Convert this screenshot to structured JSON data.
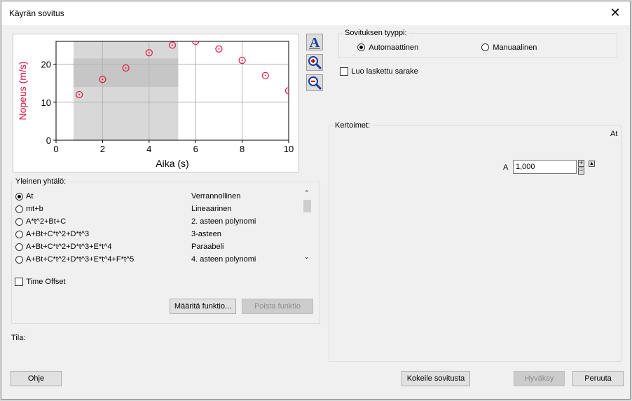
{
  "window": {
    "title": "Käyrän sovitus",
    "close_label": "✕"
  },
  "fit_type": {
    "label": "Sovituksen tyyppi:",
    "options": [
      {
        "label": "Automaattinen",
        "selected": true
      },
      {
        "label": "Manuaalinen",
        "selected": false
      }
    ]
  },
  "calc_column": {
    "label": "Luo laskettu sarake",
    "checked": false
  },
  "coefficients": {
    "label": "Kertoimet:",
    "equation": "At",
    "param_name": "A",
    "param_value": "1,000"
  },
  "general_equation": {
    "label": "Yleinen yhtälö:",
    "items": [
      {
        "eq": "At",
        "desc": "Verrannollinen",
        "selected": true
      },
      {
        "eq": "mt+b",
        "desc": "Lineaarinen",
        "selected": false
      },
      {
        "eq": "A*t^2+Bt+C",
        "desc": "2. asteen polynomi",
        "selected": false
      },
      {
        "eq": "A+Bt+C*t^2+D*t^3",
        "desc": "3-asteen",
        "selected": false
      },
      {
        "eq": "A+Bt+C*t^2+D*t^3+E*t^4",
        "desc": "Paraabeli",
        "selected": false
      },
      {
        "eq": "A+Bt+C*t^2+D*t^3+E*t^4+F*t^5",
        "desc": "4. asteen polynomi",
        "selected": false
      }
    ]
  },
  "time_offset": {
    "label": "Time Offset",
    "checked": false
  },
  "buttons": {
    "define_function": "Määritä funktio...",
    "remove_function": "Poista funktio",
    "help": "Ohje",
    "try_fit": "Kokeile sovitusta",
    "accept": "Hyväksy",
    "cancel": "Peruuta"
  },
  "status_label": "Tila:",
  "colors": {
    "data_point": "#e0143c",
    "ylabel": "#e0143c",
    "selection": "#d8d8d8"
  },
  "chart_data": {
    "type": "scatter",
    "xlabel": "Aika (s)",
    "ylabel": "Nopeus (m/s)",
    "xlim": [
      0,
      10
    ],
    "ylim": [
      0,
      26
    ],
    "xticks": [
      0,
      2,
      4,
      6,
      8,
      10
    ],
    "yticks": [
      0,
      10,
      20
    ],
    "grid": true,
    "x": [
      1,
      2,
      3,
      4,
      5,
      6,
      7,
      8,
      9,
      10
    ],
    "y": [
      12,
      16,
      19,
      23,
      25,
      26,
      24,
      21,
      17,
      13
    ],
    "selection": {
      "x_range": [
        0.75,
        5.25
      ]
    }
  }
}
